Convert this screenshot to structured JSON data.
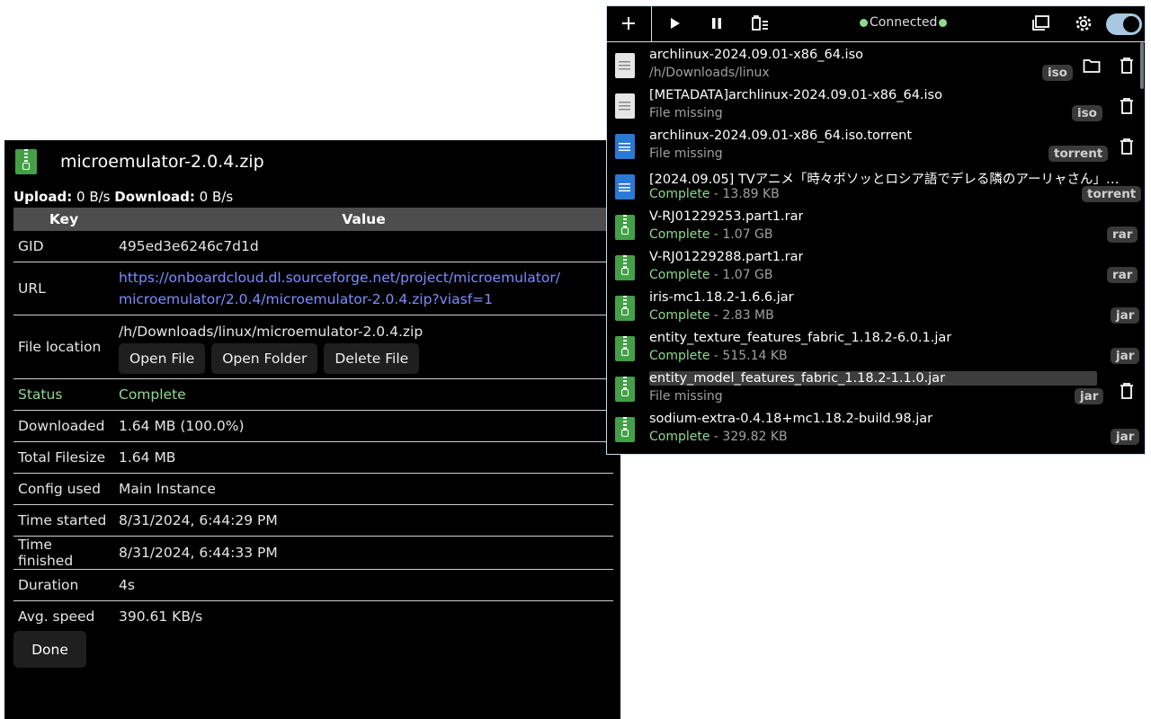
{
  "details": {
    "title": "microemulator-2.0.4.zip",
    "upload_label": "Upload:",
    "upload_value": "0 B/s",
    "download_label": "Download:",
    "download_value": "0 B/s",
    "col_key": "Key",
    "col_value": "Value",
    "rows": {
      "gid": {
        "k": "GID",
        "v": "495ed3e6246c7d1d"
      },
      "url": {
        "k": "URL",
        "v": "https://onboardcloud.dl.sourceforge.net/project/microemulator/microemulator/2.0.4/microemulator-2.0.4.zip?viasf=1",
        "v1": "https://onboardcloud.dl.sourceforge.net/project/microemulator/",
        "v2": "microemulator/2.0.4/microemulator-2.0.4.zip?viasf=1"
      },
      "location": {
        "k": "File location",
        "v": "/h/Downloads/linux/microemulator-2.0.4.zip"
      },
      "status": {
        "k": "Status",
        "v": "Complete"
      },
      "downloaded": {
        "k": "Downloaded",
        "v": "1.64 MB (100.0%)"
      },
      "filesize": {
        "k": "Total Filesize",
        "v": "1.64 MB"
      },
      "config": {
        "k": "Config used",
        "v": "Main Instance"
      },
      "started": {
        "k": "Time started",
        "v": "8/31/2024, 6:44:29 PM"
      },
      "finished": {
        "k": "Time finished",
        "v": "8/31/2024, 6:44:33 PM"
      },
      "duration": {
        "k": "Duration",
        "v": "4s"
      },
      "speed": {
        "k": "Avg. speed",
        "v": "390.61 KB/s"
      }
    },
    "buttons": {
      "open_file": "Open File",
      "open_folder": "Open Folder",
      "delete_file": "Delete File",
      "done": "Done"
    }
  },
  "popup": {
    "status_text": "Connected",
    "icons": [
      "plus-icon",
      "play-icon",
      "pause-icon",
      "clear-list-icon",
      "window-icon",
      "gear-icon",
      "toggle"
    ],
    "items": [
      {
        "name": "archlinux-2024.09.01-x86_64.iso",
        "status": "/h/Downloads/linux",
        "size": "",
        "badge": "iso",
        "type": "doc",
        "folder": true,
        "trash": true
      },
      {
        "name": "[METADATA]archlinux-2024.09.01-x86_64.iso",
        "status": "File missing",
        "size": "",
        "badge": "iso",
        "type": "doc",
        "folder": false,
        "trash": true
      },
      {
        "name": "archlinux-2024.09.01-x86_64.iso.torrent",
        "status": "File missing",
        "size": "",
        "badge": "torrent",
        "type": "torr",
        "folder": false,
        "trash": true
      },
      {
        "name": "[2024.09.05] TVアニメ「時々ボソッとロシア語でデレる隣のアーリャさん」…",
        "status": "Complete",
        "size": " - 13.89 KB",
        "badge": "torrent",
        "type": "torr",
        "folder": false,
        "trash": false
      },
      {
        "name": "V-RJ01229253.part1.rar",
        "status": "Complete",
        "size": " - 1.07 GB",
        "badge": "rar",
        "type": "zip",
        "folder": false,
        "trash": false
      },
      {
        "name": "V-RJ01229288.part1.rar",
        "status": "Complete",
        "size": " - 1.07 GB",
        "badge": "rar",
        "type": "zip",
        "folder": false,
        "trash": false
      },
      {
        "name": "iris-mc1.18.2-1.6.6.jar",
        "status": "Complete",
        "size": " - 2.83 MB",
        "badge": "jar",
        "type": "zip",
        "folder": false,
        "trash": false
      },
      {
        "name": "entity_texture_features_fabric_1.18.2-6.0.1.jar",
        "status": "Complete",
        "size": " - 515.14 KB",
        "badge": "jar",
        "type": "zip",
        "folder": false,
        "trash": false
      },
      {
        "name": "entity_model_features_fabric_1.18.2-1.1.0.jar",
        "status": "File missing",
        "size": "",
        "badge": "jar",
        "type": "zip",
        "folder": false,
        "trash": true
      },
      {
        "name": "sodium-extra-0.4.18+mc1.18.2-build.98.jar",
        "status": "Complete",
        "size": " - 329.82 KB",
        "badge": "jar",
        "type": "zip",
        "folder": false,
        "trash": false
      }
    ]
  }
}
